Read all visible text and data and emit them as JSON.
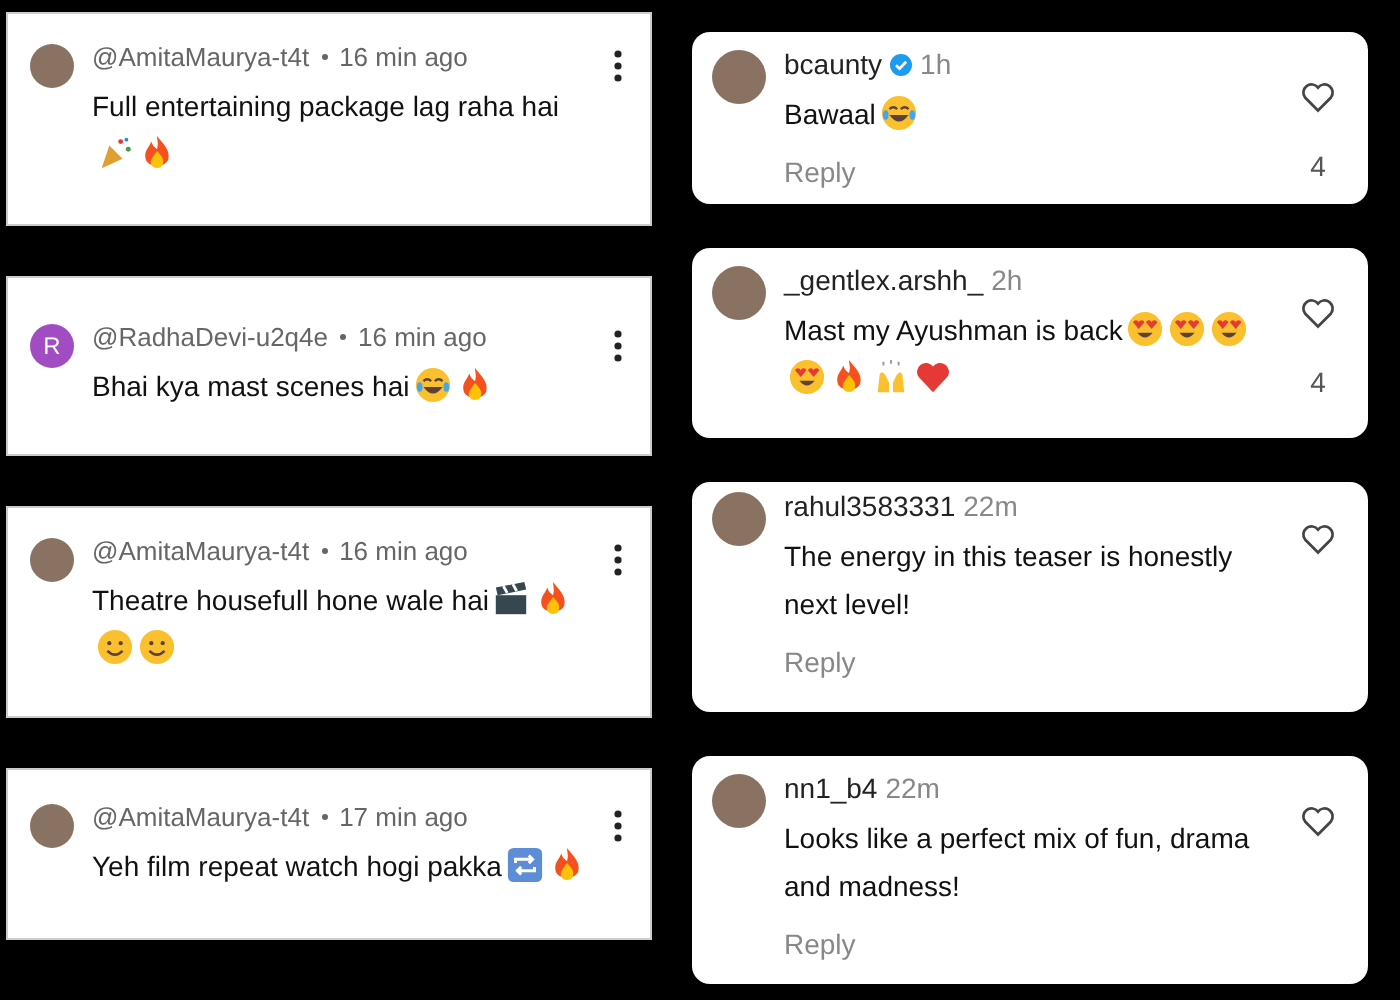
{
  "youtube_comments": [
    {
      "author": "@AmitaMaurya-t4t",
      "time": "16 min ago",
      "avatar": {
        "kind": "photo"
      },
      "text": "Full entertaining package lag raha hai",
      "reactions": [
        {
          "kind": "party"
        },
        {
          "kind": "fire"
        }
      ]
    },
    {
      "author": "@RadhaDevi-u2q4e",
      "time": "16 min ago",
      "avatar": {
        "kind": "letter",
        "letter": "R"
      },
      "text": "Bhai kya mast scenes hai",
      "reactions": [
        {
          "kind": "joy"
        },
        {
          "kind": "fire"
        }
      ]
    },
    {
      "author": "@AmitaMaurya-t4t",
      "time": "16 min ago",
      "avatar": {
        "kind": "photo"
      },
      "text": "Theatre housefull hone wale hai",
      "reactions": [
        {
          "kind": "clapper"
        },
        {
          "kind": "fire"
        },
        {
          "kind": "smile"
        },
        {
          "kind": "smile"
        }
      ]
    },
    {
      "author": "@AmitaMaurya-t4t",
      "time": "17 min ago",
      "avatar": {
        "kind": "photo"
      },
      "text": "Yeh film repeat watch hogi pakka",
      "reactions": [
        {
          "kind": "repeat"
        },
        {
          "kind": "fire"
        }
      ]
    }
  ],
  "instagram_comments": [
    {
      "author": "bcaunty",
      "verified": true,
      "time": "1h",
      "text": "Bawaal",
      "reactions": [
        {
          "kind": "joy"
        }
      ],
      "likes": "4",
      "reply": "Reply"
    },
    {
      "author": "_gentlex.arshh_",
      "verified": false,
      "time": "2h",
      "text": "Mast my Ayushman is back",
      "reactions": [
        {
          "kind": "hearteyes"
        },
        {
          "kind": "hearteyes"
        },
        {
          "kind": "hearteyes"
        },
        {
          "kind": "hearteyes"
        },
        {
          "kind": "fire"
        },
        {
          "kind": "hands"
        },
        {
          "kind": "heart"
        }
      ],
      "likes": "4"
    },
    {
      "author": "rahul3583331",
      "verified": false,
      "time": "22m",
      "text": "The energy in this teaser is honestly next level!",
      "reply": "Reply"
    },
    {
      "author": "nn1_b4",
      "verified": false,
      "time": "22m",
      "text": "Looks like a perfect mix of fun, drama and madness!",
      "reply": "Reply"
    }
  ]
}
